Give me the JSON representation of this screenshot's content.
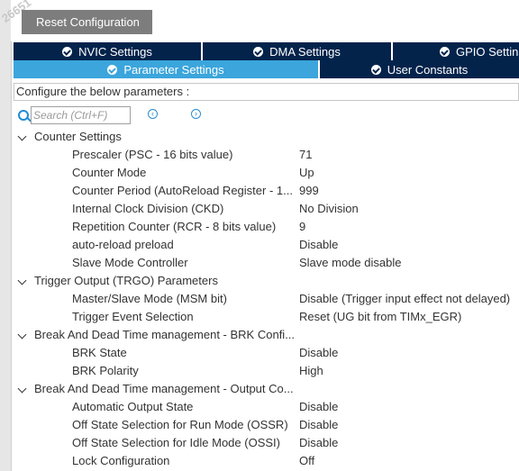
{
  "watermark": "26651",
  "reset_button": "Reset Configuration",
  "tabs_row1": [
    {
      "label": "NVIC Settings"
    },
    {
      "label": "DMA Settings"
    },
    {
      "label": "GPIO Settin"
    }
  ],
  "tabs_row2": [
    {
      "label": "Parameter Settings"
    },
    {
      "label": "User Constants"
    }
  ],
  "description": "Configure the below parameters :",
  "search": {
    "placeholder": "Search (Ctrl+F)"
  },
  "groups": [
    {
      "label": "Counter Settings",
      "params": [
        {
          "name": "Prescaler (PSC - 16 bits value)",
          "value": "71"
        },
        {
          "name": "Counter Mode",
          "value": "Up"
        },
        {
          "name": "Counter Period (AutoReload Register - 1...",
          "value": "999"
        },
        {
          "name": "Internal Clock Division (CKD)",
          "value": "No Division"
        },
        {
          "name": "Repetition Counter (RCR - 8 bits value)",
          "value": "9"
        },
        {
          "name": "auto-reload preload",
          "value": "Disable"
        },
        {
          "name": "Slave Mode Controller",
          "value": "Slave mode disable"
        }
      ]
    },
    {
      "label": "Trigger Output (TRGO) Parameters",
      "params": [
        {
          "name": "Master/Slave Mode (MSM bit)",
          "value": "Disable (Trigger input effect not delayed)"
        },
        {
          "name": "Trigger Event Selection",
          "value": "Reset (UG bit from TIMx_EGR)"
        }
      ]
    },
    {
      "label": "Break And Dead Time management - BRK Confi...",
      "params": [
        {
          "name": "BRK State",
          "value": "Disable"
        },
        {
          "name": "BRK Polarity",
          "value": "High"
        }
      ]
    },
    {
      "label": "Break And Dead Time management - Output Co...",
      "params": [
        {
          "name": "Automatic Output State",
          "value": "Disable"
        },
        {
          "name": "Off State Selection for Run Mode (OSSR)",
          "value": "Disable"
        },
        {
          "name": "Off State Selection for Idle Mode (OSSI)",
          "value": "Disable"
        },
        {
          "name": "Lock Configuration",
          "value": "Off"
        }
      ]
    }
  ]
}
